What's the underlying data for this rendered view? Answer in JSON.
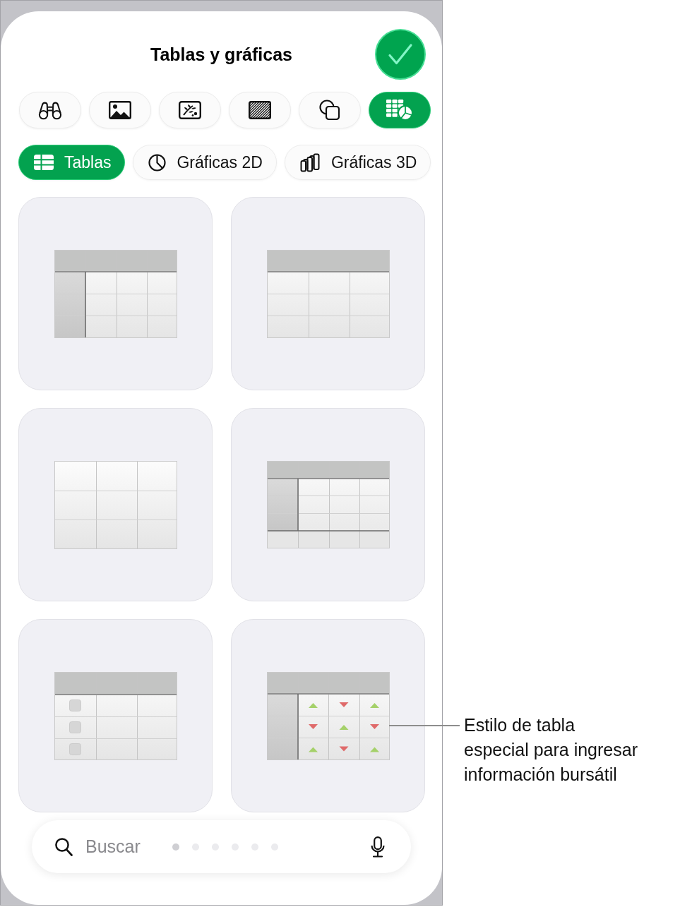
{
  "window": {
    "title": "Tablas y gráficas"
  },
  "categories": [
    {
      "kind": "binoculars",
      "selected": false
    },
    {
      "kind": "picture",
      "selected": false
    },
    {
      "kind": "sticker",
      "selected": false
    },
    {
      "kind": "pattern",
      "selected": false
    },
    {
      "kind": "shapes",
      "selected": false
    },
    {
      "kind": "tablechart",
      "selected": true
    }
  ],
  "tabs": [
    {
      "label": "Tablas",
      "kind": "table",
      "selected": true
    },
    {
      "label": "Gráficas 2D",
      "kind": "pie",
      "selected": false
    },
    {
      "label": "Gráficas 3D",
      "kind": "bars",
      "selected": false
    }
  ],
  "table_styles": [
    {
      "kind": "rowcol"
    },
    {
      "kind": "header"
    },
    {
      "kind": "plain"
    },
    {
      "kind": "footer"
    },
    {
      "kind": "checkbox"
    },
    {
      "kind": "stock"
    }
  ],
  "search": {
    "placeholder": "Buscar"
  },
  "page_indicator": [
    {
      "selected": true
    },
    {
      "selected": false
    },
    {
      "selected": false
    },
    {
      "selected": false
    },
    {
      "selected": false
    },
    {
      "selected": false
    }
  ],
  "callout": {
    "lines": [
      "Estilo de tabla",
      "especial para ingresar",
      "información bursátil"
    ]
  }
}
